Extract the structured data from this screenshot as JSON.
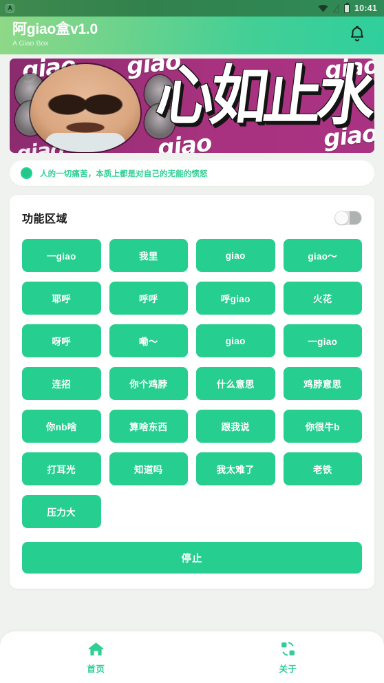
{
  "status_bar": {
    "app_badge": "A",
    "time": "10:41",
    "icons": [
      "wifi-icon",
      "no-signal-icon",
      "battery-icon"
    ]
  },
  "header": {
    "title": "阿giao盒v1.0",
    "subtitle": "A Giao Box",
    "bell_icon": "bell-icon",
    "gradient_from": "#8fd987",
    "gradient_to": "#2ecf9d"
  },
  "banner": {
    "headline": "心如止水",
    "watermark": "giao",
    "bg_from": "#8a2b6e",
    "bg_to": "#aa3283"
  },
  "notice": {
    "text": "人的一切痛苦，本质上都是对自己的无能的愤怒",
    "dot_icon": "circle-dot-icon",
    "color": "#2fcf95"
  },
  "function_card": {
    "title": "功能区域",
    "toggle": {
      "name": "function-toggle",
      "state": "off"
    },
    "accent": "#26ce8f",
    "buttons": [
      "一giao",
      "我里",
      "giao",
      "giao〜",
      "耶呼",
      "呼呼",
      "呼giao",
      "火花",
      "呀呼",
      "嘞〜",
      "giao",
      "一giao",
      "连招",
      "你个鸡脖",
      "什么意思",
      "鸡脖意思",
      "你nb啥",
      "算啥东西",
      "跟我说",
      "你很牛b",
      "打耳光",
      "知道吗",
      "我太难了",
      "老铁",
      "压力大"
    ],
    "stop_label": "停止"
  },
  "bottom_nav": {
    "items": [
      {
        "label": "首页",
        "icon": "home-icon",
        "active": true
      },
      {
        "label": "关于",
        "icon": "about-sync-icon",
        "active": false
      }
    ],
    "color": "#2fcf95"
  }
}
